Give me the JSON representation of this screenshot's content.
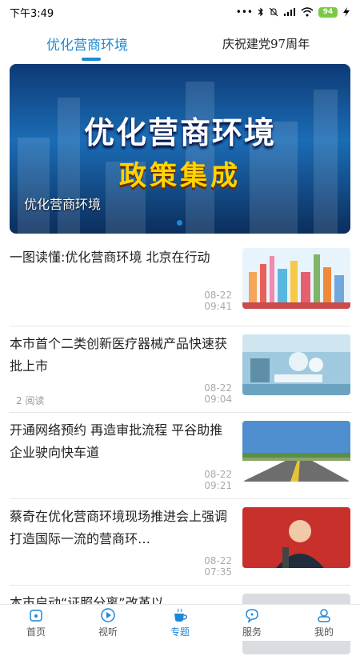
{
  "status": {
    "time": "下午3:49",
    "battery": "94"
  },
  "tabs": [
    {
      "label": "优化营商环境"
    },
    {
      "label": "庆祝建党97周年"
    }
  ],
  "banner": {
    "line1": "优化营商环境",
    "line2": "政策集成",
    "caption": "优化营商环境"
  },
  "news": [
    {
      "title": "一图读懂:优化营商环境 北京在行动",
      "reads": "",
      "time": "08-22 09:41"
    },
    {
      "title": "本市首个二类创新医疗器械产品快速获批上市",
      "reads": "2 阅读",
      "time": "08-22 09:04"
    },
    {
      "title": "开通网络预约 再造审批流程 平谷助推企业驶向快车道",
      "reads": "",
      "time": "08-22 09:21"
    },
    {
      "title": "蔡奇在优化营商环境现场推进会上强调 打造国际一流的营商环…",
      "reads": "",
      "time": "08-22 07:35"
    },
    {
      "title": "本市启动“证照分离”改革以",
      "reads": "",
      "time": ""
    }
  ],
  "tabbar": [
    {
      "label": "首页",
      "icon": "home-icon"
    },
    {
      "label": "视听",
      "icon": "play-icon"
    },
    {
      "label": "专题",
      "icon": "cup-icon"
    },
    {
      "label": "服务",
      "icon": "chat-icon"
    },
    {
      "label": "我的",
      "icon": "user-icon"
    }
  ],
  "colors": {
    "accent": "#1e88d6",
    "banner_highlight": "#ffd400"
  }
}
